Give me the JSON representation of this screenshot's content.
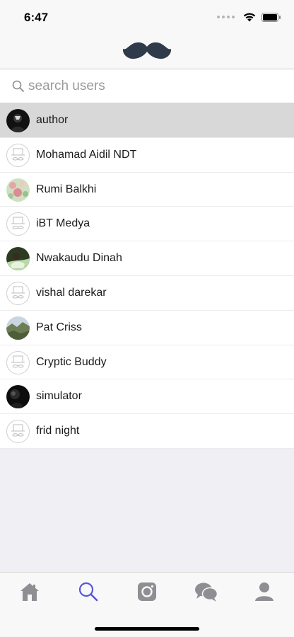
{
  "status_bar": {
    "time": "6:47"
  },
  "header": {
    "logo_icon": "mustache-icon"
  },
  "search": {
    "placeholder": "search users",
    "value": ""
  },
  "users": [
    {
      "name": "author",
      "avatar": "photo-dark",
      "selected": true
    },
    {
      "name": "Mohamad Aidil NDT",
      "avatar": "default-mustache",
      "selected": false
    },
    {
      "name": "Rumi Balkhi",
      "avatar": "photo-floral",
      "selected": false
    },
    {
      "name": "iBT Medya",
      "avatar": "default-mustache",
      "selected": false
    },
    {
      "name": "Nwakaudu Dinah",
      "avatar": "photo-person",
      "selected": false
    },
    {
      "name": "vishal darekar",
      "avatar": "default-mustache",
      "selected": false
    },
    {
      "name": "Pat Criss",
      "avatar": "photo-landscape",
      "selected": false
    },
    {
      "name": "Cryptic Buddy",
      "avatar": "default-mustache",
      "selected": false
    },
    {
      "name": "simulator",
      "avatar": "photo-dark",
      "selected": false
    },
    {
      "name": "frid night",
      "avatar": "default-mustache",
      "selected": false
    }
  ],
  "tabs": [
    {
      "icon": "home-icon",
      "active": false
    },
    {
      "icon": "search-icon",
      "active": true
    },
    {
      "icon": "camera-icon",
      "active": false
    },
    {
      "icon": "chat-icon",
      "active": false
    },
    {
      "icon": "profile-icon",
      "active": false
    }
  ],
  "colors": {
    "accent": "#5856d6",
    "inactive_icon": "#8e8e93",
    "selected_row": "#d8d8d8",
    "logo": "#2f3b4a"
  }
}
